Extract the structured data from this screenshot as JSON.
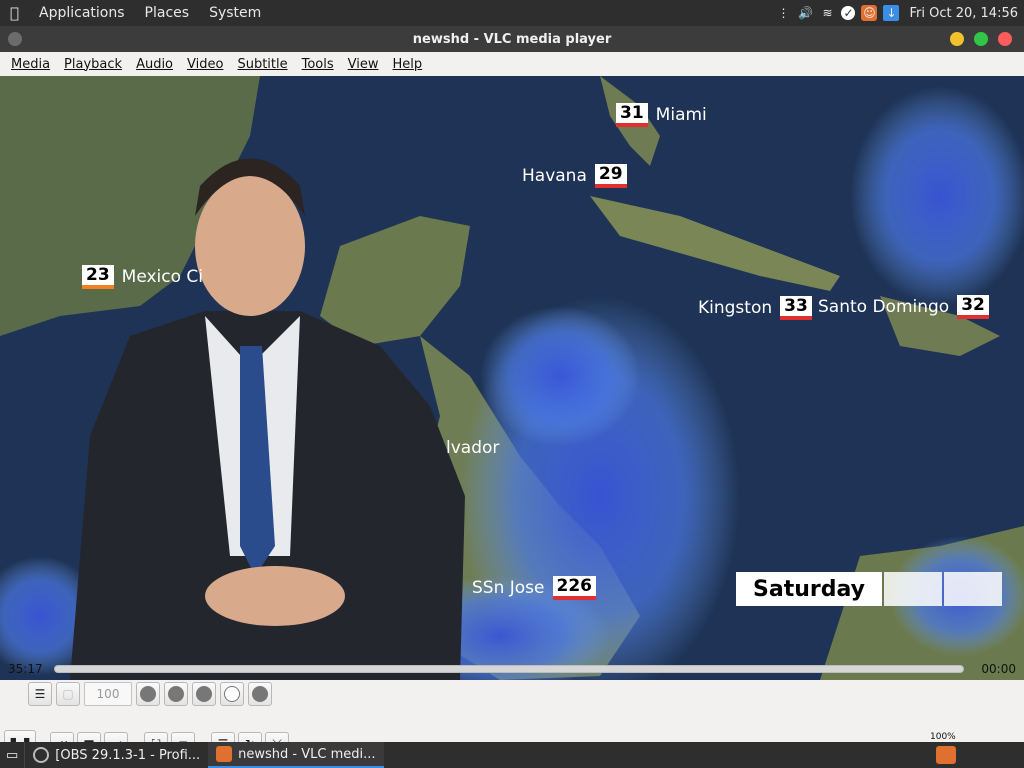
{
  "top_panel": {
    "menus": [
      "Applications",
      "Places",
      "System"
    ],
    "clock": "Fri Oct 20, 14:56"
  },
  "window": {
    "title": "newshd - VLC media player"
  },
  "menubar": {
    "items": [
      "Media",
      "Playback",
      "Audio",
      "Video",
      "Subtitle",
      "Tools",
      "View",
      "Help"
    ]
  },
  "video": {
    "labels": [
      {
        "name": "Miami",
        "temp": "31"
      },
      {
        "name": "Havana",
        "temp": "29"
      },
      {
        "name": "Mexico Ci",
        "temp": "23"
      },
      {
        "name": "Kingston",
        "temp": "33"
      },
      {
        "name": "Santo Domingo",
        "temp": "32"
      },
      {
        "name": "lvador",
        "temp": ""
      },
      {
        "name": "SSn Jose",
        "temp": "226"
      }
    ],
    "day_banner": "Saturday"
  },
  "playback": {
    "elapsed": "35:17",
    "remaining": "00:00",
    "speed_value": "100",
    "volume_percent": "100%",
    "volume_level": 1.0
  },
  "taskbar": {
    "items": [
      "[OBS 29.1.3-1 - Profi...",
      "newshd - VLC medi..."
    ]
  }
}
